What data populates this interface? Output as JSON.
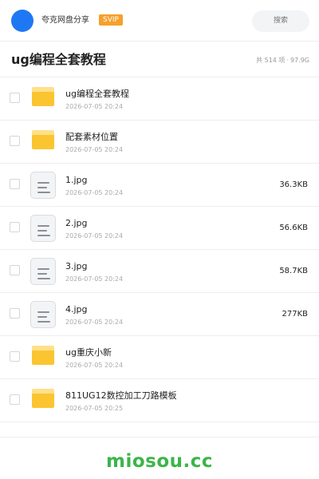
{
  "header": {
    "owner_name": "夸克网盘分享",
    "badge": "SVIP",
    "search_placeholder": "搜索",
    "avatar_color": "#1f78f3"
  },
  "folder": {
    "title": "ug编程全套教程",
    "count": "共 514 项",
    "separator": "·",
    "size": "97.9G"
  },
  "items": [
    {
      "type": "folder",
      "icon": "folder-icon",
      "name": "ug编程全套教程",
      "time": "2026-07-05 20:24",
      "size": ""
    },
    {
      "type": "folder",
      "icon": "folder-icon",
      "name": "配套素材位置",
      "time": "2026-07-05 20:24",
      "size": ""
    },
    {
      "type": "file",
      "icon": "image-file-icon",
      "name": "1.jpg",
      "time": "2026-07-05 20:24",
      "size": "36.3KB"
    },
    {
      "type": "file",
      "icon": "image-file-icon",
      "name": "2.jpg",
      "time": "2026-07-05 20:24",
      "size": "56.6KB"
    },
    {
      "type": "file",
      "icon": "image-file-icon",
      "name": "3.jpg",
      "time": "2026-07-05 20:24",
      "size": "58.7KB"
    },
    {
      "type": "file",
      "icon": "image-file-icon",
      "name": "4.jpg",
      "time": "2026-07-05 20:24",
      "size": "277KB"
    },
    {
      "type": "folder",
      "icon": "folder-icon",
      "name": "ug重庆小新",
      "time": "2026-07-05 20:24",
      "size": ""
    },
    {
      "type": "folder",
      "icon": "folder-icon",
      "name": "811UG12数控加工刀路模板",
      "time": "2026-07-05 20:25",
      "size": ""
    }
  ],
  "footer": {
    "watermark": "miosou.cc",
    "watermark_color": "#3bb54a"
  }
}
